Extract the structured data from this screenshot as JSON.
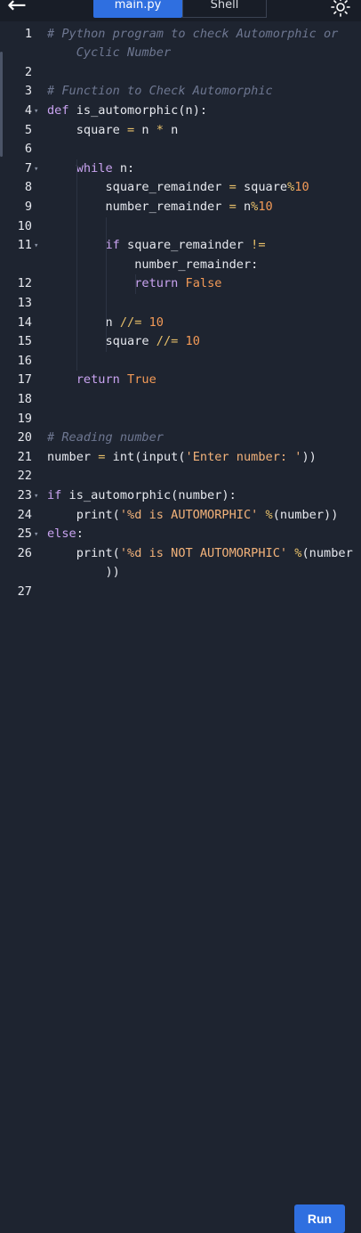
{
  "header": {
    "tabs": [
      {
        "label": "main.py",
        "active": true
      },
      {
        "label": "Shell",
        "active": false
      }
    ],
    "back_icon": "arrow-left-icon",
    "theme_icon": "sun-icon"
  },
  "editor": {
    "lines": [
      {
        "n": "1",
        "fold": false,
        "tokens": [
          {
            "t": "# Python program to check Automorphic or",
            "c": "cm"
          }
        ]
      },
      {
        "n": "",
        "fold": false,
        "tokens": [
          {
            "t": "    Cyclic Number",
            "c": "cm"
          }
        ]
      },
      {
        "n": "2",
        "fold": false,
        "tokens": []
      },
      {
        "n": "3",
        "fold": false,
        "tokens": [
          {
            "t": "# Function to Check Automorphic",
            "c": "cm"
          }
        ]
      },
      {
        "n": "4",
        "fold": true,
        "tokens": [
          {
            "t": "def",
            "c": "kw"
          },
          {
            "t": " is_automorphic(n):",
            "c": "bi"
          }
        ]
      },
      {
        "n": "5",
        "fold": false,
        "tokens": [
          {
            "t": "    square ",
            "c": "bi"
          },
          {
            "t": "=",
            "c": "op"
          },
          {
            "t": " n ",
            "c": "bi"
          },
          {
            "t": "*",
            "c": "op"
          },
          {
            "t": " n",
            "c": "bi"
          }
        ]
      },
      {
        "n": "6",
        "fold": false,
        "tokens": []
      },
      {
        "n": "7",
        "fold": true,
        "tokens": [
          {
            "t": "    while",
            "c": "kw"
          },
          {
            "t": " n:",
            "c": "bi"
          }
        ]
      },
      {
        "n": "8",
        "fold": false,
        "tokens": [
          {
            "t": "        square_remainder ",
            "c": "bi"
          },
          {
            "t": "=",
            "c": "op"
          },
          {
            "t": " square",
            "c": "bi"
          },
          {
            "t": "%",
            "c": "op"
          },
          {
            "t": "10",
            "c": "num"
          }
        ]
      },
      {
        "n": "9",
        "fold": false,
        "tokens": [
          {
            "t": "        number_remainder ",
            "c": "bi"
          },
          {
            "t": "=",
            "c": "op"
          },
          {
            "t": " n",
            "c": "bi"
          },
          {
            "t": "%",
            "c": "op"
          },
          {
            "t": "10",
            "c": "num"
          }
        ]
      },
      {
        "n": "10",
        "fold": false,
        "tokens": []
      },
      {
        "n": "11",
        "fold": true,
        "tokens": [
          {
            "t": "        if",
            "c": "kw"
          },
          {
            "t": " square_remainder ",
            "c": "bi"
          },
          {
            "t": "!=",
            "c": "op"
          }
        ]
      },
      {
        "n": "",
        "fold": false,
        "tokens": [
          {
            "t": "            number_remainder:",
            "c": "bi"
          }
        ]
      },
      {
        "n": "12",
        "fold": false,
        "tokens": [
          {
            "t": "            return",
            "c": "kw"
          },
          {
            "t": " False",
            "c": "num"
          }
        ]
      },
      {
        "n": "13",
        "fold": false,
        "tokens": []
      },
      {
        "n": "14",
        "fold": false,
        "tokens": [
          {
            "t": "        n ",
            "c": "bi"
          },
          {
            "t": "//=",
            "c": "op"
          },
          {
            "t": " 10",
            "c": "num"
          }
        ]
      },
      {
        "n": "15",
        "fold": false,
        "tokens": [
          {
            "t": "        square ",
            "c": "bi"
          },
          {
            "t": "//=",
            "c": "op"
          },
          {
            "t": " 10",
            "c": "num"
          }
        ]
      },
      {
        "n": "16",
        "fold": false,
        "tokens": []
      },
      {
        "n": "17",
        "fold": false,
        "tokens": [
          {
            "t": "    return",
            "c": "kw"
          },
          {
            "t": " True",
            "c": "num"
          }
        ]
      },
      {
        "n": "18",
        "fold": false,
        "tokens": []
      },
      {
        "n": "19",
        "fold": false,
        "tokens": []
      },
      {
        "n": "20",
        "fold": false,
        "tokens": [
          {
            "t": "# Reading number",
            "c": "cm"
          }
        ]
      },
      {
        "n": "21",
        "fold": false,
        "tokens": [
          {
            "t": "number ",
            "c": "bi"
          },
          {
            "t": "=",
            "c": "op"
          },
          {
            "t": " int(input(",
            "c": "bi"
          },
          {
            "t": "'Enter number: '",
            "c": "str"
          },
          {
            "t": "))",
            "c": "bi"
          }
        ]
      },
      {
        "n": "22",
        "fold": false,
        "tokens": []
      },
      {
        "n": "23",
        "fold": true,
        "tokens": [
          {
            "t": "if",
            "c": "kw"
          },
          {
            "t": " is_automorphic(number):",
            "c": "bi"
          }
        ]
      },
      {
        "n": "24",
        "fold": false,
        "tokens": [
          {
            "t": "    print(",
            "c": "bi"
          },
          {
            "t": "'%d is AUTOMORPHIC'",
            "c": "str"
          },
          {
            "t": " ",
            "c": "bi"
          },
          {
            "t": "%",
            "c": "op"
          },
          {
            "t": "(number))",
            "c": "bi"
          }
        ]
      },
      {
        "n": "25",
        "fold": true,
        "tokens": [
          {
            "t": "else",
            "c": "kw"
          },
          {
            "t": ":",
            "c": "bi"
          }
        ]
      },
      {
        "n": "26",
        "fold": false,
        "tokens": [
          {
            "t": "    print(",
            "c": "bi"
          },
          {
            "t": "'%d is NOT AUTOMORPHIC'",
            "c": "str"
          },
          {
            "t": " ",
            "c": "bi"
          },
          {
            "t": "%",
            "c": "op"
          },
          {
            "t": "(number",
            "c": "bi"
          }
        ]
      },
      {
        "n": "",
        "fold": false,
        "tokens": [
          {
            "t": "        ))",
            "c": "bi"
          }
        ]
      },
      {
        "n": "27",
        "fold": false,
        "tokens": []
      }
    ]
  },
  "footer": {
    "run_label": "Run"
  },
  "colors": {
    "accent": "#2f6fe0",
    "background": "#1e2430",
    "keyword": "#c9a3f0",
    "comment": "#6e7791",
    "number": "#f39a57",
    "string": "#f2b27a",
    "operator": "#e8c06a"
  }
}
